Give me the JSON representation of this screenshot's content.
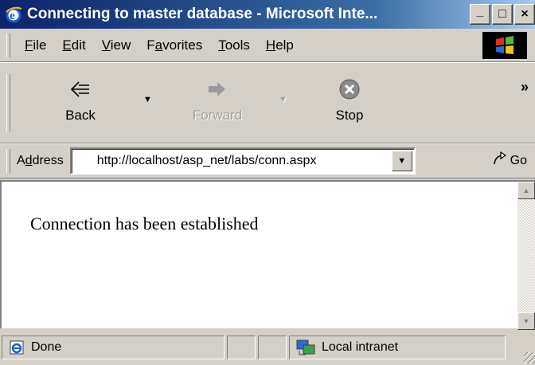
{
  "window": {
    "title": "Connecting to master database - Microsoft Inte...",
    "controls": {
      "minimize": "_",
      "maximize": "□",
      "close": "×"
    }
  },
  "menu": {
    "items": [
      {
        "accel": "F",
        "rest": "ile"
      },
      {
        "accel": "E",
        "rest": "dit"
      },
      {
        "accel": "V",
        "rest": "iew"
      },
      {
        "pre": "F",
        "accel": "a",
        "rest": "vorites"
      },
      {
        "accel": "T",
        "rest": "ools"
      },
      {
        "accel": "H",
        "rest": "elp"
      }
    ]
  },
  "toolbar": {
    "back_label": "Back",
    "forward_label": "Forward",
    "stop_label": "Stop",
    "more": "»",
    "icons": {
      "back": "back-arrow-icon",
      "forward": "forward-arrow-icon",
      "stop": "stop-icon"
    }
  },
  "address": {
    "label_pre": "A",
    "label_accel": "d",
    "label_rest": "dress",
    "url": "http://localhost/asp_net/labs/conn.aspx",
    "go_label": "Go"
  },
  "page": {
    "message": "Connection has been established"
  },
  "status": {
    "text": "Done",
    "zone": "Local intranet"
  },
  "colors": {
    "titlebar_start": "#0a246a",
    "titlebar_end": "#a6caf0",
    "chrome": "#d4d0c8"
  }
}
